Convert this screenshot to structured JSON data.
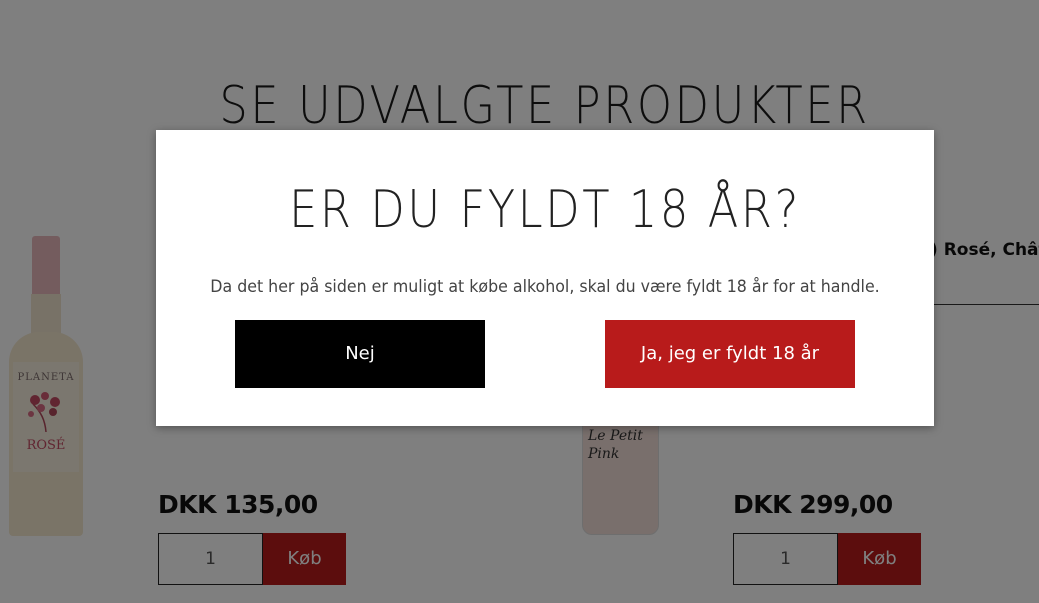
{
  "section": {
    "title": "SE UDVALGTE PRODUKTER"
  },
  "products": [
    {
      "brand": "PLANETA",
      "label": "ROSÉ",
      "price": "DKK 135,00",
      "qty": "1",
      "buy": "Køb"
    },
    {
      "label": "Le Petit Pink",
      "name_partial": ") Rosé, Châte",
      "price": "DKK 299,00",
      "qty": "1",
      "buy": "Køb"
    }
  ],
  "modal": {
    "title": "ER DU FYLDT 18 ÅR?",
    "text": "Da det her på siden er muligt at købe alkohol, skal du være fyldt 18 år for at handle.",
    "no_label": "Nej",
    "yes_label": "Ja, jeg er fyldt 18 år"
  },
  "colors": {
    "accent": "#b81b1b",
    "overlay": "rgba(0,0,0,0.5)"
  }
}
